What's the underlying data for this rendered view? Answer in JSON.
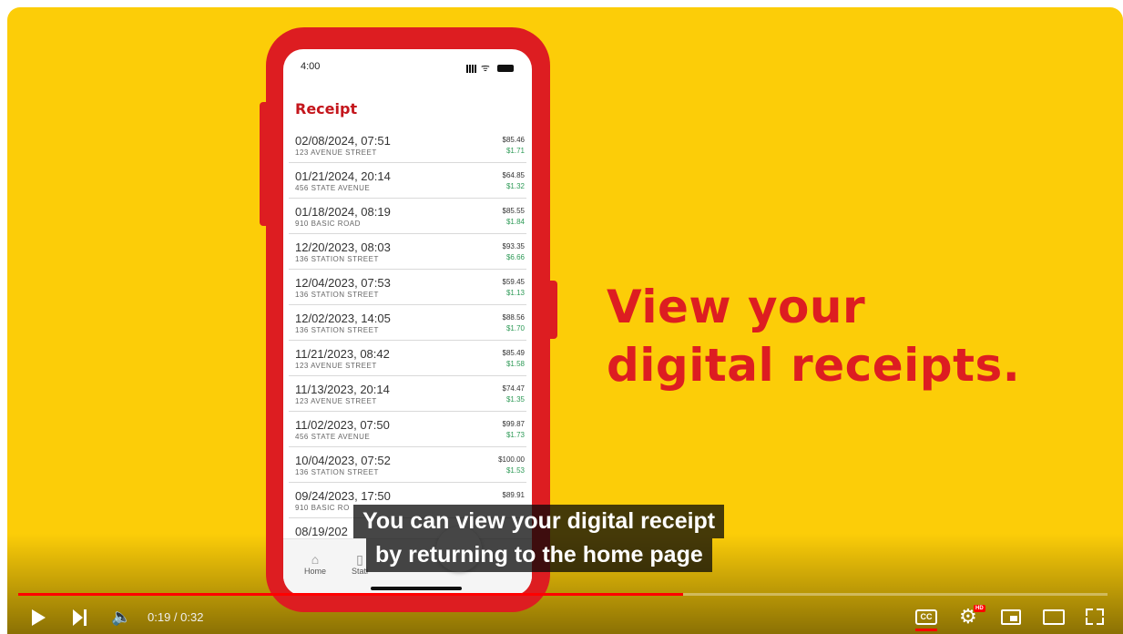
{
  "phone": {
    "status_time": "4:00",
    "screen_title": "Receipt",
    "receipts": [
      {
        "date": "02/08/2024, 07:51",
        "address": "123 AVENUE STREET",
        "total": "$85.46",
        "savings": "$1.71"
      },
      {
        "date": "01/21/2024, 20:14",
        "address": "456 STATE AVENUE",
        "total": "$64.85",
        "savings": "$1.32"
      },
      {
        "date": "01/18/2024, 08:19",
        "address": "910 BASIC ROAD",
        "total": "$85.55",
        "savings": "$1.84"
      },
      {
        "date": "12/20/2023, 08:03",
        "address": "136 STATION STREET",
        "total": "$93.35",
        "savings": "$6.66"
      },
      {
        "date": "12/04/2023, 07:53",
        "address": "136 STATION STREET",
        "total": "$59.45",
        "savings": "$1.13"
      },
      {
        "date": "12/02/2023, 14:05",
        "address": "136 STATION STREET",
        "total": "$88.56",
        "savings": "$1.70"
      },
      {
        "date": "11/21/2023, 08:42",
        "address": "123 AVENUE STREET",
        "total": "$85.49",
        "savings": "$1.58"
      },
      {
        "date": "11/13/2023, 20:14",
        "address": "123 AVENUE STREET",
        "total": "$74.47",
        "savings": "$1.35"
      },
      {
        "date": "11/02/2023, 07:50",
        "address": "456 STATE AVENUE",
        "total": "$99.87",
        "savings": "$1.73"
      },
      {
        "date": "10/04/2023, 07:52",
        "address": "136 STATION STREET",
        "total": "$100.00",
        "savings": "$1.53"
      },
      {
        "date": "09/24/2023, 17:50",
        "address": "910 BASIC RO",
        "total": "$89.91",
        "savings": ""
      },
      {
        "date": "08/19/202",
        "address": "",
        "total": "",
        "savings": ""
      }
    ],
    "tabs": [
      {
        "label": "Home",
        "icon": "home-icon"
      },
      {
        "label": "Stati",
        "icon": "map-icon"
      }
    ]
  },
  "headline": {
    "line1": "View your",
    "line2": "digital receipts."
  },
  "captions": {
    "line1": "You can view your digital receipt",
    "line2": "by returning to the home page"
  },
  "player": {
    "time_display": "0:19 / 0:32",
    "progress": 0.61,
    "hd_badge": "HD",
    "cc_label": "CC"
  },
  "colors": {
    "background": "#fccd08",
    "brand_red": "#dd1d21",
    "progress_red": "#ff0000",
    "savings_green": "#2e9a57"
  }
}
